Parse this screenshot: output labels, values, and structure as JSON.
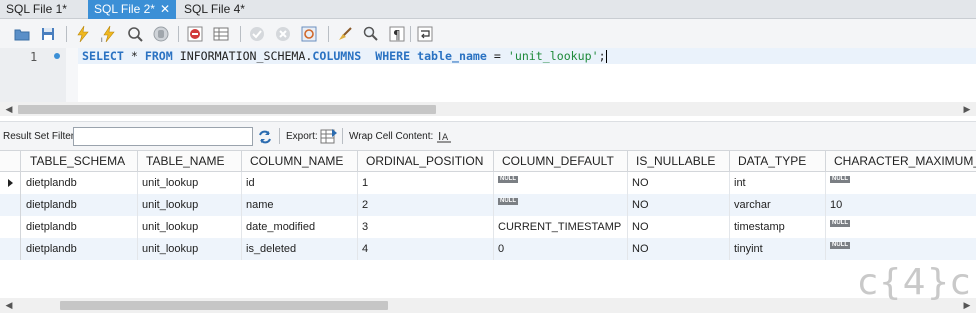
{
  "tabs": [
    {
      "label": "SQL File 1*",
      "active": false
    },
    {
      "label": "SQL File 2*",
      "active": true
    },
    {
      "label": "SQL File 4*",
      "active": false
    }
  ],
  "toolbar": {
    "icons": [
      "open-folder-icon",
      "save-icon",
      "execute-lightning-icon",
      "execute-current-lightning-icon",
      "explain-magnifier-icon",
      "stop-hand-icon",
      "toggle-continue-on-error-icon",
      "toggle-output-icon",
      "commit-check-icon",
      "rollback-x-icon",
      "autocommit-icon",
      "beautify-broom-icon",
      "find-icon",
      "invisible-chars-icon",
      "wrap-lines-icon"
    ]
  },
  "editor": {
    "line_number": "1",
    "query": {
      "select": "SELECT",
      "star": " * ",
      "from": "FROM",
      "schema": " INFORMATION_SCHEMA.",
      "columns": "COLUMNS",
      "where": "  WHERE ",
      "table_name": "table_name",
      "eq": " = ",
      "value": "'unit_lookup'",
      "semicolon": ";"
    }
  },
  "filter_bar": {
    "result_filter_label": "Result Set Filter:",
    "filter_value": "",
    "export_label": "Export:",
    "wrap_label": "Wrap Cell Content:"
  },
  "grid": {
    "columns": [
      "TABLE_SCHEMA",
      "TABLE_NAME",
      "COLUMN_NAME",
      "ORDINAL_POSITION",
      "COLUMN_DEFAULT",
      "IS_NULLABLE",
      "DATA_TYPE",
      "CHARACTER_MAXIMUM_LE"
    ],
    "null_label": "NULL",
    "rows": [
      [
        "dietplandb",
        "unit_lookup",
        "id",
        "1",
        null,
        "NO",
        "int",
        null
      ],
      [
        "dietplandb",
        "unit_lookup",
        "name",
        "2",
        null,
        "NO",
        "varchar",
        "10"
      ],
      [
        "dietplandb",
        "unit_lookup",
        "date_modified",
        "3",
        "CURRENT_TIMESTAMP",
        "NO",
        "timestamp",
        null
      ],
      [
        "dietplandb",
        "unit_lookup",
        "is_deleted",
        "4",
        "0",
        "NO",
        "tinyint",
        null
      ]
    ]
  },
  "watermark": "c{4}c",
  "colors": {
    "accent": "#3b8fd6",
    "keyword": "#2a72c2",
    "string": "#1e8a3a",
    "alt_row": "#eef4fb"
  }
}
